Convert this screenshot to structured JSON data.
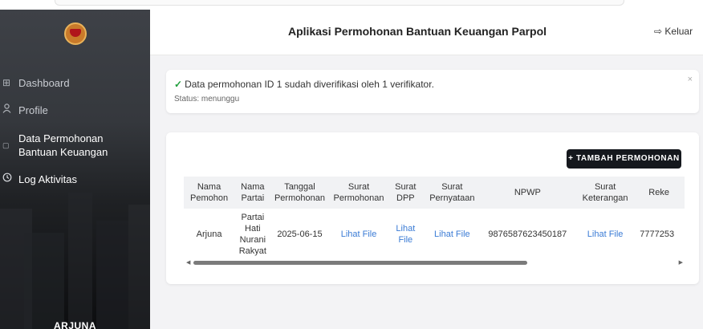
{
  "sidebar": {
    "items": [
      {
        "label": "Dashboard",
        "icon": "grid-icon"
      },
      {
        "label": "Profile",
        "icon": "user-icon"
      },
      {
        "label": "Data Permohonan Bantuan Keuangan",
        "line1": "Data Permohonan",
        "line2": "Bantuan Keuangan",
        "icon": "document-icon"
      },
      {
        "label": "Log Aktivitas",
        "icon": "history-icon"
      }
    ],
    "user_name": "ARJUNA"
  },
  "header": {
    "title": "Aplikasi Permohonan Bantuan Keuangan Parpol",
    "logout_label": "Keluar"
  },
  "alert": {
    "message": "Data permohonan ID 1 sudah diverifikasi oleh 1 verifikator.",
    "status": "Status: menunggu",
    "close": "×"
  },
  "table_card": {
    "add_button": "+ TAMBAH PERMOHONAN",
    "columns": [
      {
        "line1": "Nama",
        "line2": "Pemohon"
      },
      {
        "line1": "Nama",
        "line2": "Partai"
      },
      {
        "line1": "Tanggal",
        "line2": "Permohonan"
      },
      {
        "line1": "Surat",
        "line2": "Permohonan"
      },
      {
        "line1": "Surat",
        "line2": "DPP"
      },
      {
        "line1": "Surat",
        "line2": "Pernyataan"
      },
      {
        "line1": "NPWP",
        "line2": ""
      },
      {
        "line1": "Surat",
        "line2": "Keterangan"
      },
      {
        "line1": "Reke",
        "line2": ""
      }
    ],
    "rows": [
      {
        "nama_pemohon": "Arjuna",
        "partai_lines": [
          "Partai",
          "Hati",
          "Nurani",
          "Rakyat"
        ],
        "tanggal": "2025-06-15",
        "surat_permohonan": "Lihat File",
        "surat_dpp_lines": [
          "Lihat",
          "File"
        ],
        "surat_pernyataan": "Lihat File",
        "npwp": "9876587623450187",
        "surat_keterangan": "Lihat File",
        "rekening": "7777253"
      }
    ]
  },
  "colors": {
    "accent_link": "#3a7bd5",
    "success": "#1e9e3a",
    "button_bg": "#15181d"
  }
}
